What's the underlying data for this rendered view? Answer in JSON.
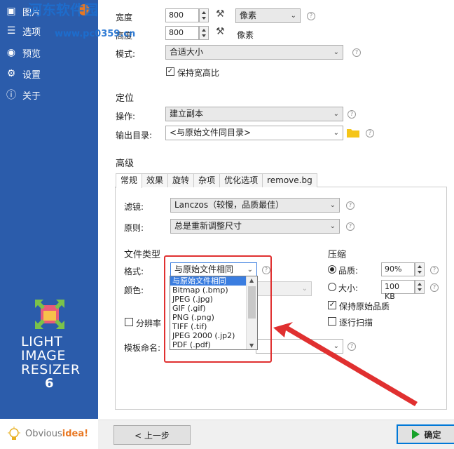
{
  "sidebar": {
    "items": [
      {
        "label": "图片",
        "icon": "image-icon"
      },
      {
        "label": "选项",
        "icon": "sliders-icon"
      },
      {
        "label": "预览",
        "icon": "eye-icon"
      },
      {
        "label": "设置",
        "icon": "gear-icon"
      },
      {
        "label": "关于",
        "icon": "info-icon"
      }
    ],
    "logo": {
      "line1": "LIGHT",
      "line2": "IMAGE",
      "line3": "RESIZER",
      "version": "6"
    },
    "brand": {
      "prefix": "Obvious",
      "accent": "idea!"
    }
  },
  "watermark": {
    "title": "河东软件园",
    "url": "www.pc0359.cn"
  },
  "resize": {
    "width_label": "宽度",
    "width_value": "800",
    "height_label": "高度",
    "height_value": "800",
    "unit_select": "像素",
    "unit_label": "像素",
    "mode_label": "模式:",
    "mode_value": "合适大小",
    "keep_ratio_label": "保持宽高比",
    "keep_ratio_checked": true
  },
  "location": {
    "section_title": "定位",
    "operation_label": "操作:",
    "operation_value": "建立副本",
    "output_label": "输出目录:",
    "output_value": "<与原始文件同目录>"
  },
  "advanced": {
    "section_title": "高级",
    "tabs": [
      "常规",
      "效果",
      "旋转",
      "杂项",
      "优化选项",
      "remove.bg"
    ],
    "active_tab": "常规",
    "filter_label": "滤镜:",
    "filter_value": "Lanczos（较慢，品质最佳）",
    "rule_label": "原则:",
    "rule_value": "总是重新调整尺寸",
    "filetype_title": "文件类型",
    "format_label": "格式:",
    "format_value": "与原始文件相同",
    "color_label": "颜色:",
    "resolution_label": "分辨率",
    "template_label": "模板命名:",
    "format_options": [
      "与原始文件相同",
      "Bitmap (.bmp)",
      "JPEG (.jpg)",
      "GIF (.gif)",
      "PNG (.png)",
      "TIFF (.tif)",
      "JPEG 2000 (.jp2)",
      "PDF (.pdf)"
    ],
    "compress_title": "压缩",
    "quality_label": "品质:",
    "quality_value": "90%",
    "size_label": "大小:",
    "size_value": "100 KB",
    "keep_quality_label": "保持原始品质",
    "keep_quality_checked": true,
    "progressive_label": "逐行扫描",
    "progressive_checked": false
  },
  "footer": {
    "back_label": "< 上一步",
    "ok_label": "确定"
  },
  "colors": {
    "sidebar": "#2b5cab",
    "accent": "#e87722",
    "highlight": "#e03030",
    "play": "#17a22a"
  }
}
